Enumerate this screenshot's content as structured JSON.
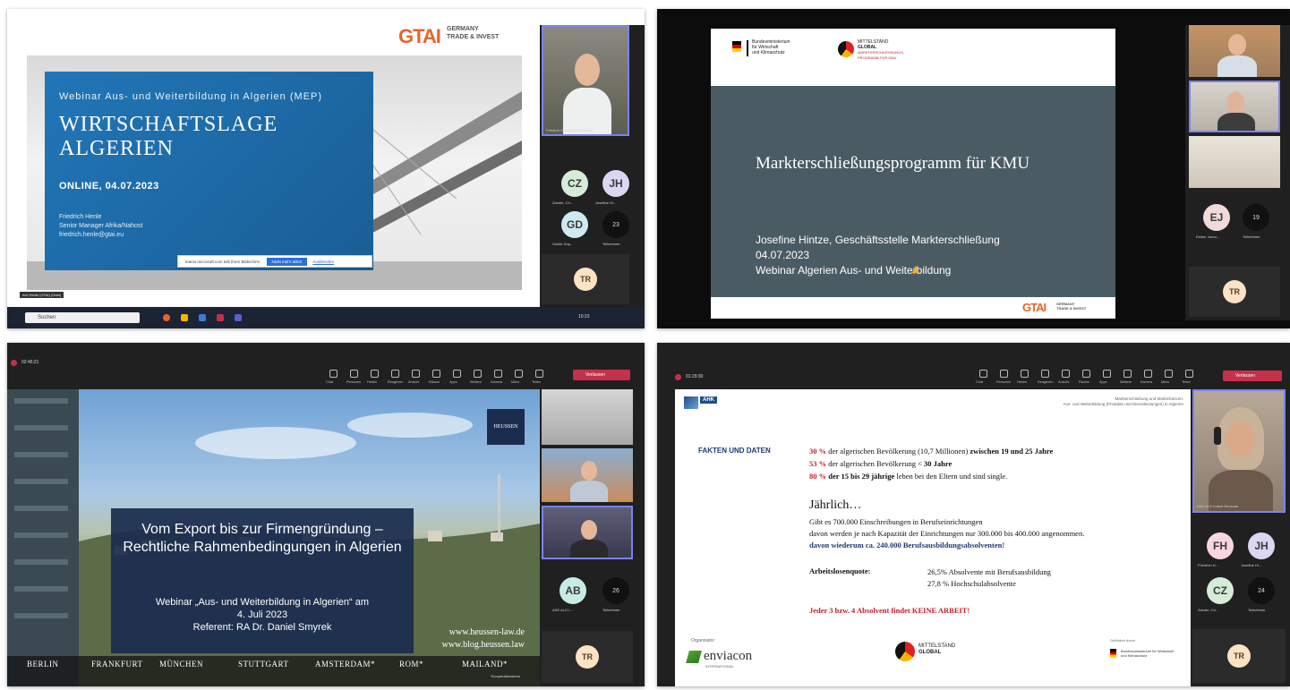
{
  "colors": {
    "teams_dark": "#202020",
    "teams_tile": "#2b2b2b",
    "leave_red": "#c4314b",
    "gtai_orange": "#e8642c",
    "slide_gray": "#4b5b63",
    "slide_blue": "#1e6aa8",
    "red_text": "#c0212b",
    "navy_box": "#1b2d4f"
  },
  "panel1": {
    "gtai_logo": "GTAI",
    "gtai_text_1": "GERMANY",
    "gtai_text_2": "TRADE & INVEST",
    "subtitle": "Webinar Aus- und Weiterbildung in Algerien (MEP)",
    "title_1": "WIRTSCHAFTSLAGE",
    "title_2": "ALGERIEN",
    "date": "ONLINE, 04.07.2023",
    "presenter_name": "Friedrich Henle",
    "presenter_role": "Senior Manager Afrika/Nahost",
    "presenter_email": "friedrich.henle@gtai.eu",
    "share_text": "teams.microsoft.com teilt Ihren Bildschirm.",
    "share_stop": "Nicht mehr teilen",
    "share_hide": "Ausblenden",
    "video_label": "Friedrich Henle (GTAI) (Gast)",
    "bottom_label": "rich Henle (GTAI) (Gast)",
    "taskbar_search": "Suchen",
    "taskbar_time": "10:23",
    "avatars": [
      {
        "initials": "CZ",
        "label": "Zander, Ch...",
        "color": "#d5ecd9"
      },
      {
        "initials": "JH",
        "label": "Josefine Hi...",
        "color": "#dad7f2"
      },
      {
        "initials": "GD",
        "label": "Gaelle Dup...",
        "color": "#cfe9f1"
      }
    ],
    "count": "23",
    "count_label": "Teilnehmer",
    "self_initials": "TR"
  },
  "panel2": {
    "ministry_1": "Bundesministerium",
    "ministry_2": "für Wirtschaft",
    "ministry_3": "und Klimaschutz",
    "mittelstand_1": "MITTELSTAND",
    "mittelstand_2": "GLOBAL",
    "mittelstand_3": "MARKTERSCHLIESSUNGS-",
    "mittelstand_4": "PROGRAMM FÜR KMU",
    "title": "Markterschließungsprogramm für KMU",
    "line_1": "Josefine Hintze, Geschäftsstelle Markterschließung",
    "line_2": "04.07.2023",
    "line_3": "Webinar Algerien Aus- und Weiterbildung",
    "gtai_logo": "GTAI",
    "gtai_text_1": "GERMANY",
    "gtai_text_2": "TRADE & INVEST",
    "avatar": {
      "initials": "EJ",
      "label": "Esther Jacco...",
      "color": "#f3dada"
    },
    "count": "19",
    "count_label": "Teilnehmer",
    "self_initials": "TR"
  },
  "panel3": {
    "timer": "02:46:21",
    "toolbar": [
      "Chat",
      "Personen",
      "Heben",
      "Reagieren",
      "Ansicht",
      "Räume",
      "Apps",
      "Weitere",
      "Kamera",
      "Mikro",
      "Teilen"
    ],
    "leave": "Verlassen",
    "heussen": "HEUSSEN",
    "box_title": "Vom Export bis zur Firmengründung – Rechtliche Rahmenbedingungen in Algerien",
    "box_sub_1": "Webinar „Aus- und Weiterbildung in Algerien“ am",
    "box_sub_2": "4. Juli 2023",
    "box_sub_3": "Referent: RA Dr. Daniel Smyrek",
    "url_1": "www.heussen-law.de",
    "url_2": "www.blog.heussen.law",
    "cities": [
      "BERLIN",
      "FRANKFURT",
      "MÜNCHEN",
      "STUTTGART",
      "AMSTERDAM*",
      "ROM*",
      "MAILAND*"
    ],
    "coop": "*Kooperationsbüro",
    "avatar": {
      "initials": "AB",
      "label": "AHK ALG L...",
      "color": "#c7ece7"
    },
    "count": "26",
    "count_label": "Teilnehmer",
    "self_initials": "TR"
  },
  "panel4": {
    "timer": "01:29:30",
    "toolbar": [
      "Chat",
      "Personen",
      "Heben",
      "Reagieren",
      "Ansicht",
      "Räume",
      "Apps",
      "Weitere",
      "Kamera",
      "Mikro",
      "Teilen"
    ],
    "leave": "Verlassen",
    "ahk": "AHK",
    "header_right_1": "Markterschließung und Marktchancen:",
    "header_right_2": "Aus- und Weiterbildung (Produkte und Dienstleistungen) in Algerien",
    "section": "FAKTEN UND DATEN",
    "fact_1_pct": "30 %",
    "fact_1_text": "der algerischen Bevölkerung  (10,7 Millionen)",
    "fact_1_bold": "zwischen 19 und 25 Jahre",
    "fact_2_pct": "53 %",
    "fact_2_text": "der algerischen Bevölkerung  <",
    "fact_2_bold": "30 Jahre",
    "fact_3_pct": "80 %",
    "fact_3_bold": "der 15 bis 29 jährige",
    "fact_3_text": "leben bei den Eltern und sind single.",
    "annual_title": "Jährlich…",
    "annual_1": "Gibt es 700.000 Einschreibungen in Berufseinrichtungen",
    "annual_2": "davon werden je nach Kapazität der Einrichtungen nur 300.000 bis 400.000 angenommen.",
    "annual_3": "davon wiederum ca. 240.000 Berufsausbildungsabsolventen!",
    "unemp_label": "Arbeitslosenquote:",
    "unemp_1": "26,5%  Absolvente mit Berufsausbildung",
    "unemp_2": "27,8 % Hochschulabsolvente",
    "conclusion": "Jeder 3 bzw. 4 Absolvent findet KEINE ARBEIT!",
    "organisator": "Organisator",
    "enviacon": "enviacon",
    "enviacon_sub": "INTERNATIONAL",
    "mittelstand_1": "MITTELSTAND",
    "mittelstand_2": "GLOBAL",
    "gefoerdert": "Gefördert durch",
    "ministry": "Bundesministerium für Wirtschaft und Klimaschutz",
    "video_label": "AHK ALG Imane Boussaa",
    "avatars": [
      {
        "initials": "FH",
        "label": "Friedrich H...",
        "color": "#f8d5e0"
      },
      {
        "initials": "JH",
        "label": "Josefine Hi...",
        "color": "#dad7f2"
      },
      {
        "initials": "CZ",
        "label": "Zander, Ch...",
        "color": "#d5ecd9"
      }
    ],
    "count": "24",
    "count_label": "Teilnehmer",
    "self_initials": "TR"
  }
}
